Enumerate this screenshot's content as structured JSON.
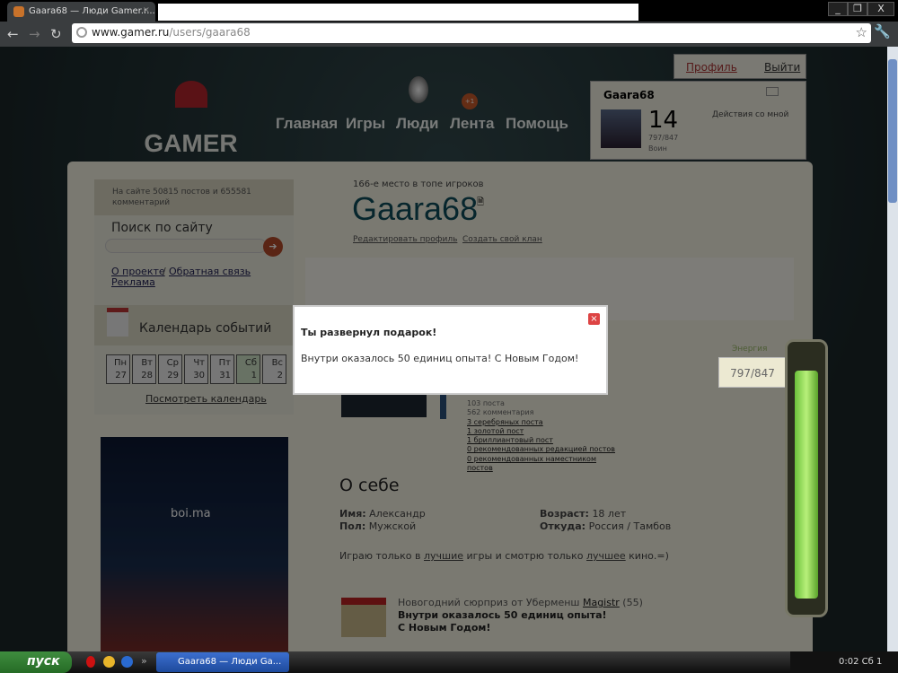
{
  "browser": {
    "tab_title": "Gaara68 — Люди Gamer.r...",
    "url_host": "www.gamer.ru",
    "url_path": "/users/gaara68"
  },
  "header": {
    "logo": "GAMER",
    "nav": [
      "Главная",
      "Игры",
      "Люди",
      "Лента",
      "Помощь"
    ],
    "badge": "+1",
    "profile_link": "Профиль",
    "logout_link": "Выйти"
  },
  "user_card": {
    "name": "Gaara68",
    "level": "14",
    "xp": "797/847",
    "rank": "Воин",
    "actions": "Действия со мной"
  },
  "sidebar": {
    "stats": "На сайте 50815 постов и 655581 комментарий",
    "search_title": "Поиск по сайту",
    "links": [
      "О проекте",
      "Обратная связь",
      "Реклама"
    ],
    "calendar_title": "Календарь событий",
    "days": [
      {
        "d": "Пн",
        "n": "27"
      },
      {
        "d": "Вт",
        "n": "28"
      },
      {
        "d": "Ср",
        "n": "29"
      },
      {
        "d": "Чт",
        "n": "30"
      },
      {
        "d": "Пт",
        "n": "31"
      },
      {
        "d": "Сб",
        "n": "1"
      },
      {
        "d": "Вс",
        "n": "2"
      }
    ],
    "calendar_link": "Посмотреть календарь",
    "banner_text": "boi.ma"
  },
  "profile": {
    "rank_text": "166-е место в топе игроков",
    "username": "Gaara68",
    "edit_link": "Редактировать профиль",
    "clan_link": "Создать свой клан",
    "stats": [
      "103 поста",
      "562 комментария"
    ],
    "stat_links": [
      "3 серебряных поста",
      "1 золотой пост",
      "1 бриллиантовый пост",
      "0 рекомендованных редакцией постов",
      "0 рекомендованных наместником постов"
    ],
    "about_title": "О себе",
    "name_label": "Имя:",
    "name": "Александр",
    "sex_label": "Пол:",
    "sex": "Мужской",
    "age_label": "Возраст:",
    "age": "18 лет",
    "from_label": "Откуда:",
    "from": "Россия / Тамбов",
    "bio_1": "Играю только в ",
    "bio_link1": "лучшие",
    "bio_2": " игры и смотрю только ",
    "bio_link2": "лучшее",
    "bio_3": " кино.=)",
    "gift_from": "Новогодний сюрприз от Уберменш ",
    "gift_user": "Magistr",
    "gift_level": " (55)",
    "gift_msg1": "Внутри оказалось 50 единиц опыта!",
    "gift_msg2": "С Новым Годом!"
  },
  "energy": {
    "label": "Энергия",
    "value": "797/847",
    "fraction": 0.94
  },
  "dialog": {
    "title": "Ты развернул подарок!",
    "message": "Внутри оказалось 50 единиц опыта! С Новым Годом!"
  },
  "taskbar": {
    "start": "пуск",
    "task": "Gaara68 — Люди Ga...",
    "clock": "0:02 Сб 1"
  }
}
